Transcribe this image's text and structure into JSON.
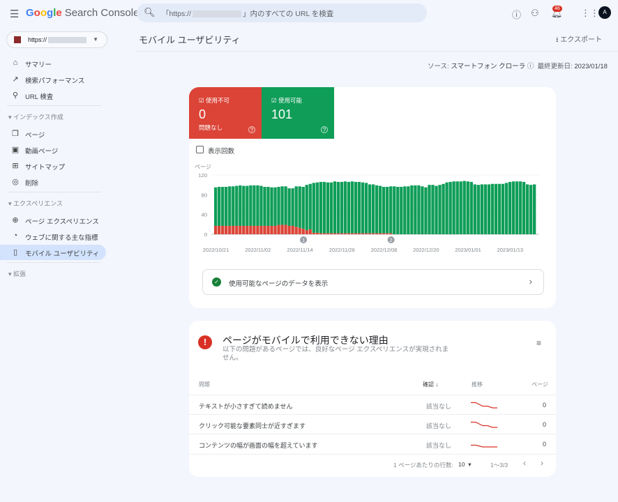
{
  "app": {
    "brand": "Google",
    "product": "Search Console",
    "notifications": "46",
    "avatar_letter": "A"
  },
  "search": {
    "prefix": "「https://",
    "suffix": "」内のすべての URL を検査"
  },
  "property": {
    "url": "https://"
  },
  "sidebar": {
    "items": [
      {
        "label": "サマリー",
        "icon": "home-icon"
      },
      {
        "label": "検索パフォーマンス",
        "icon": "trending-icon"
      },
      {
        "label": "URL 検査",
        "icon": "search-icon"
      }
    ],
    "sections": [
      {
        "label": "インデックス作成",
        "items": [
          {
            "label": "ページ",
            "icon": "pages-icon"
          },
          {
            "label": "動画ページ",
            "icon": "video-icon"
          },
          {
            "label": "サイトマップ",
            "icon": "sitemap-icon"
          },
          {
            "label": "削除",
            "icon": "eye-off-icon"
          }
        ]
      },
      {
        "label": "エクスペリエンス",
        "items": [
          {
            "label": "ページ エクスペリエンス",
            "icon": "plus-circle-icon"
          },
          {
            "label": "ウェブに関する主な指標",
            "icon": "gauge-icon"
          },
          {
            "label": "モバイル ユーザビリティ",
            "icon": "phone-icon",
            "active": true
          }
        ]
      },
      {
        "label": "拡張",
        "items": []
      }
    ]
  },
  "header": {
    "title": "モバイル ユーザビリティ",
    "export_label": "エクスポート",
    "source_label": "ソース:",
    "source_value": "スマートフォン クローラ",
    "updated_label": "最終更新日:",
    "updated_value": "2023/01/18"
  },
  "tiles": [
    {
      "label": "使用不可",
      "value": "0",
      "sub": "問題なし",
      "color": "#db4437"
    },
    {
      "label": "使用可能",
      "value": "101",
      "sub": "",
      "color": "#0f9d58"
    }
  ],
  "impressions_label": "表示回数",
  "chart_data": {
    "type": "bar",
    "stacked": true,
    "ylabel": "ページ",
    "ylim": [
      0,
      120
    ],
    "yticks": [
      0,
      40,
      80,
      120
    ],
    "start_date": "2022/10/21",
    "x_tick_labels": [
      "2022/10/21",
      "2022/11/02",
      "2022/11/14",
      "2022/11/26",
      "2022/12/08",
      "2022/12/20",
      "2023/01/01",
      "2023/01/13"
    ],
    "annotations": [
      {
        "label": "1",
        "date": "2022/11/15"
      },
      {
        "label": "2",
        "date": "2022/12/10"
      }
    ],
    "series": [
      {
        "key": "unusable",
        "color": "#db4437",
        "values": [
          17,
          17,
          17,
          17,
          17,
          17,
          17,
          17,
          17,
          17,
          17,
          17,
          17,
          17,
          17,
          17,
          17,
          17,
          19,
          19,
          19,
          17,
          17,
          15,
          13,
          11,
          8,
          10,
          3,
          3,
          2,
          2,
          2,
          2,
          2,
          2,
          2,
          2,
          2,
          2,
          2,
          2,
          2,
          2,
          2,
          2,
          2,
          2,
          2,
          2,
          2,
          0,
          0,
          0,
          0,
          0,
          0,
          0,
          0,
          0,
          0,
          0,
          0,
          0,
          0,
          0,
          0,
          0,
          0,
          0,
          0,
          0,
          0,
          0,
          0,
          0,
          0,
          0,
          0,
          0,
          0,
          0,
          0,
          0,
          0,
          0,
          0,
          0,
          0,
          0,
          0
        ]
      },
      {
        "key": "usable",
        "color": "#0f9d58",
        "values": [
          78,
          79,
          79,
          79,
          80,
          80,
          81,
          82,
          81,
          81,
          82,
          82,
          82,
          81,
          79,
          79,
          78,
          78,
          77,
          78,
          78,
          76,
          76,
          82,
          84,
          85,
          92,
          92,
          101,
          102,
          104,
          104,
          103,
          103,
          105,
          104,
          104,
          105,
          104,
          105,
          104,
          104,
          103,
          102,
          99,
          99,
          97,
          96,
          94,
          94,
          95,
          97,
          96,
          96,
          97,
          97,
          99,
          99,
          99,
          97,
          95,
          100,
          100,
          98,
          100,
          102,
          105,
          106,
          107,
          107,
          107,
          108,
          107,
          106,
          101,
          100,
          101,
          101,
          101,
          102,
          102,
          102,
          102,
          104,
          106,
          107,
          107,
          107,
          106,
          101,
          100,
          101
        ]
      }
    ]
  },
  "usable_link": "使用可能なページのデータを表示",
  "issues": {
    "title": "ページがモバイルで利用できない理由",
    "description": "以下の問題があるページでは、良好なページ エクスペリエンスが実現されません。",
    "columns": [
      "問題",
      "確認",
      "推移",
      "ページ"
    ],
    "rows": [
      {
        "issue": "テキストが小さすぎて読めません",
        "validation": "該当なし",
        "trend": [
          3,
          3,
          1,
          1,
          0,
          0
        ],
        "pages": "0"
      },
      {
        "issue": "クリック可能な要素同士が近すぎます",
        "validation": "該当なし",
        "trend": [
          3,
          3,
          1,
          1,
          0,
          0
        ],
        "pages": "0"
      },
      {
        "issue": "コンテンツの幅が画面の幅を超えています",
        "validation": "該当なし",
        "trend": [
          1,
          1,
          0,
          0,
          0,
          0
        ],
        "pages": "0"
      }
    ],
    "rows_per_page_label": "1 ページあたりの行数:",
    "rows_per_page": "10",
    "range": "1～3/3"
  }
}
